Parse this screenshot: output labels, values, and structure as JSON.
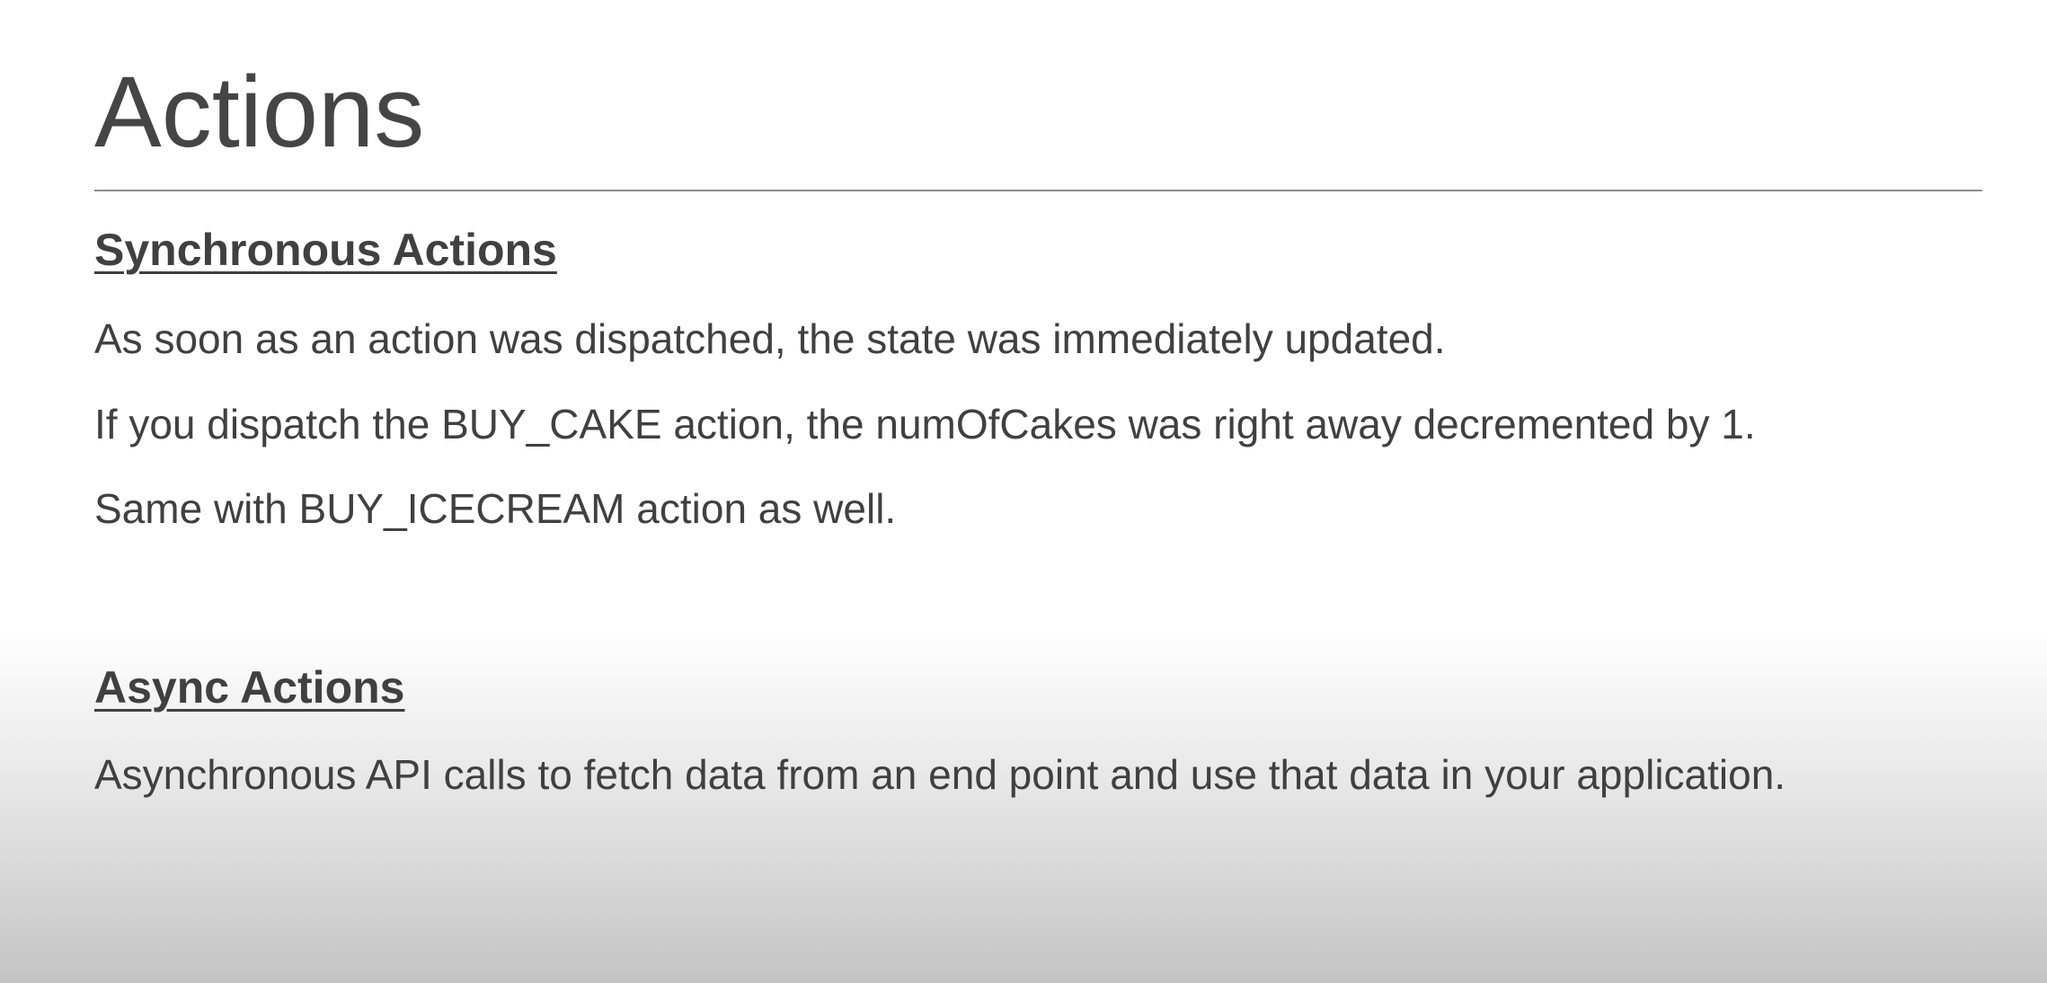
{
  "slide": {
    "title": "Actions",
    "sections": [
      {
        "heading": "Synchronous Actions",
        "lines": [
          "As soon as an action was dispatched, the state was immediately updated.",
          "If you dispatch the BUY_CAKE action, the numOfCakes was right away decremented by 1.",
          "Same with BUY_ICECREAM action as well."
        ]
      },
      {
        "heading": "Async Actions",
        "lines": [
          "Asynchronous API calls to fetch data from an end point and use that data in your application."
        ]
      }
    ]
  }
}
